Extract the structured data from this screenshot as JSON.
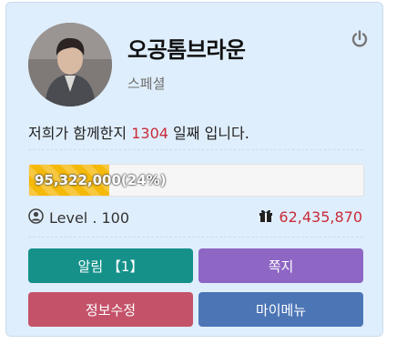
{
  "profile": {
    "name": "오공톰브라운",
    "grade": "스페셜",
    "avatar_icon": "profile-photo"
  },
  "days": {
    "prefix": "저희가 함께한지",
    "count": "1304",
    "suffix": "일째 입니다."
  },
  "experience": {
    "label": "95,322,000",
    "percent_label": "(24%)",
    "percent": 24,
    "fill_color": "#f5b90a"
  },
  "level": {
    "icon": "user-circle-icon",
    "text": "Level . 100"
  },
  "points": {
    "icon": "gift-icon",
    "value": "62,435,870",
    "color": "#c92b3a"
  },
  "buttons": {
    "alarm": "알림 【1】",
    "note": "쪽지",
    "info": "정보수정",
    "menu": "마이메뉴"
  },
  "colors": {
    "card_bg": "#dfeefc",
    "accent_red": "#c92b3a",
    "alarm_btn": "#15918a",
    "note_btn": "#8e66c4",
    "info_btn": "#c4536a",
    "menu_btn": "#4c75b6"
  }
}
